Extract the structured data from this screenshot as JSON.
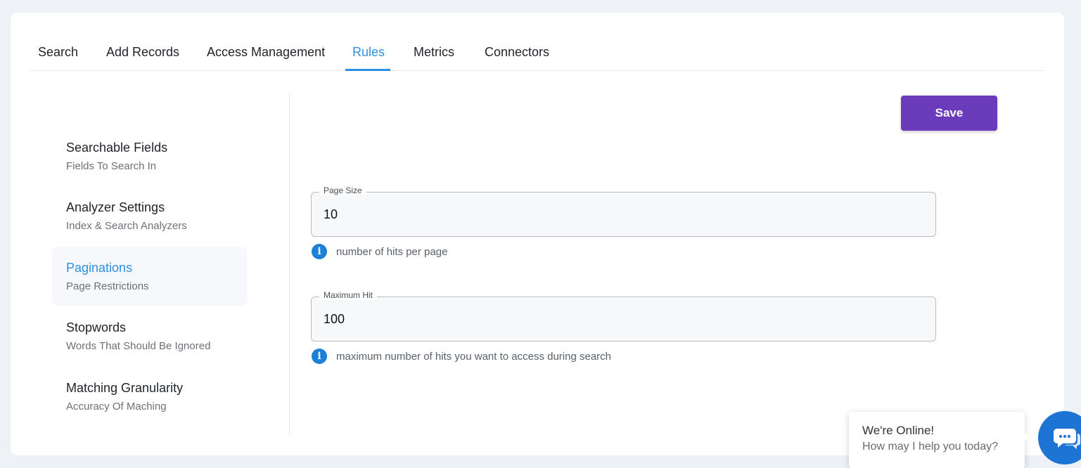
{
  "tabs": [
    {
      "label": "Search"
    },
    {
      "label": "Add Records"
    },
    {
      "label": "Access Management"
    },
    {
      "label": "Rules",
      "active": true
    },
    {
      "label": "Metrics"
    },
    {
      "label": "Connectors"
    }
  ],
  "sidebar": {
    "items": [
      {
        "title": "Searchable Fields",
        "subtitle": "Fields To Search In"
      },
      {
        "title": "Analyzer Settings",
        "subtitle": "Index & Search Analyzers"
      },
      {
        "title": "Paginations",
        "subtitle": "Page Restrictions",
        "active": true
      },
      {
        "title": "Stopwords",
        "subtitle": "Words That Should Be Ignored"
      },
      {
        "title": "Matching Granularity",
        "subtitle": "Accuracy Of Maching"
      }
    ]
  },
  "toolbar": {
    "save_label": "Save"
  },
  "form": {
    "page_size": {
      "label": "Page Size",
      "value": "10",
      "hint": "number of hits per page"
    },
    "maximum_hit": {
      "label": "Maximum Hit",
      "value": "100",
      "hint": "maximum number of hits you want to access during search"
    }
  },
  "chat": {
    "title": "We're Online!",
    "subtitle": "How may I help you today?"
  },
  "colors": {
    "accent": "#2f8fe3",
    "save_button": "#6a3cbc",
    "info_icon": "#1e7fd6",
    "chat_launcher": "#1e74d4"
  }
}
